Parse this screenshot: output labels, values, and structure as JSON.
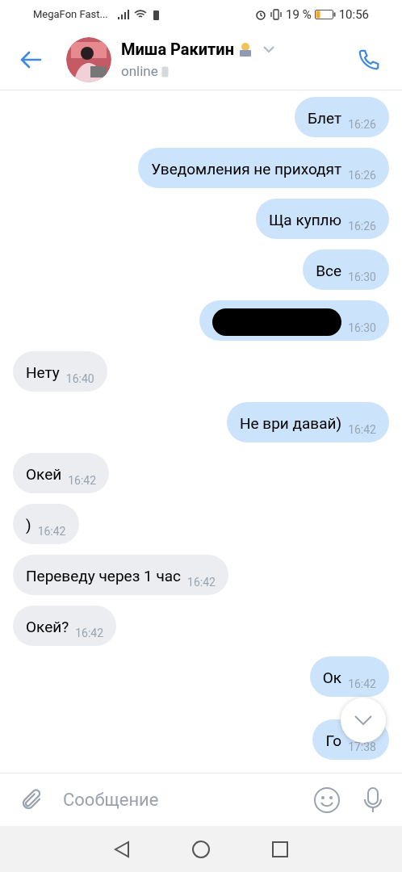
{
  "status_bar": {
    "carrier": "MegaFon Fast...",
    "battery": "19 %",
    "time": "10:56"
  },
  "header": {
    "name": "Миша Ракитин",
    "presence": "online"
  },
  "messages": [
    {
      "kind": "outgoing",
      "text": "Блет",
      "time": "16:26"
    },
    {
      "kind": "outgoing",
      "text": "Уведомления не приходят",
      "time": "16:26"
    },
    {
      "kind": "outgoing",
      "text": "Ща куплю",
      "time": "16:26"
    },
    {
      "kind": "outgoing",
      "text": "Все",
      "time": "16:30"
    },
    {
      "kind": "redacted",
      "time": "16:30"
    },
    {
      "kind": "incoming",
      "text": "Нету",
      "time": "16:40"
    },
    {
      "kind": "outgoing",
      "text": "Не ври давай)",
      "time": "16:42"
    },
    {
      "kind": "incoming",
      "text": "Окей",
      "time": "16:42"
    },
    {
      "kind": "incoming",
      "text": ")",
      "time": "16:42"
    },
    {
      "kind": "incoming",
      "text": "Переведу через 1 час",
      "time": "16:42"
    },
    {
      "kind": "incoming",
      "text": "Окей?",
      "time": "16:42"
    },
    {
      "kind": "outgoing",
      "text": "Ок",
      "time": "16:42"
    },
    {
      "kind": "outgoing",
      "text": "Го",
      "time": "17:38"
    }
  ],
  "composer": {
    "placeholder": "Сообщение"
  }
}
